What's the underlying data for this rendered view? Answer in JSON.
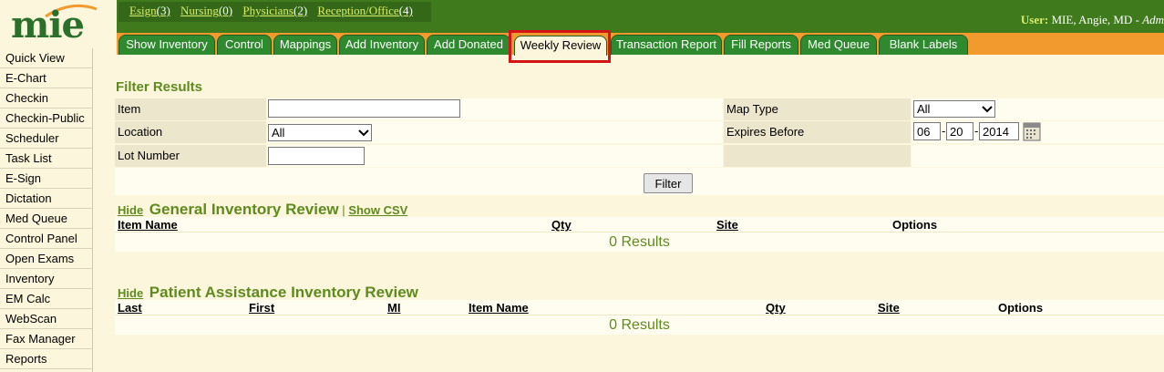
{
  "logo": {
    "text": "mie"
  },
  "top_counts": [
    {
      "label": "Esign",
      "count": "(3)"
    },
    {
      "label": "Nursing",
      "count": "(0)"
    },
    {
      "label": "Physicians",
      "count": "(2)"
    },
    {
      "label": "Reception/Office",
      "count": "(4)"
    }
  ],
  "user": {
    "label": "User:",
    "name": "MIE, Angie, MD - ",
    "role": "Adm"
  },
  "tabs": [
    "Show Inventory",
    "Control",
    "Mappings",
    "Add Inventory",
    "Add Donated",
    "Weekly Review",
    "Transaction Report",
    "Fill Reports",
    "Med Queue",
    "Blank Labels"
  ],
  "active_tab": "Weekly Review",
  "sidebar": [
    "Quick View",
    "E-Chart",
    "Checkin",
    "Checkin-Public",
    "Scheduler",
    "Task List",
    "E-Sign",
    "Dictation",
    "Med Queue",
    "Control Panel",
    "Open Exams",
    "Inventory",
    "EM Calc",
    "WebScan",
    "Fax Manager",
    "Reports"
  ],
  "filter": {
    "title": "Filter Results",
    "item_label": "Item",
    "item_value": "",
    "location_label": "Location",
    "location_value": "All",
    "lot_label": "Lot Number",
    "lot_value": "",
    "map_type_label": "Map Type",
    "map_type_value": "All",
    "expires_label": "Expires Before",
    "expires_month": "06",
    "expires_day": "20",
    "expires_year": "2014",
    "date_sep": "-",
    "button": "Filter"
  },
  "general": {
    "hide": "Hide",
    "title": "General Inventory Review",
    "sep": "|",
    "csv": "Show CSV",
    "columns": [
      "Item Name",
      "Qty",
      "Site",
      "Options"
    ],
    "results": "0 Results"
  },
  "patient": {
    "hide": "Hide",
    "title": "Patient Assistance Inventory Review",
    "columns": [
      "Last",
      "First",
      "MI",
      "Item Name",
      "Qty",
      "Site",
      "Options"
    ],
    "results": "0 Results"
  },
  "colors": {
    "header_green": "#3f7a1c",
    "tab_green": "#2f8a2f",
    "tab_strip_orange": "#f39a2e",
    "title_green": "#5f8a1f",
    "highlight_red": "#d41515",
    "page_bg": "#fbf6dc"
  },
  "icons": {
    "calendar": "calendar-icon",
    "dropdown": "chevron-down-icon"
  }
}
